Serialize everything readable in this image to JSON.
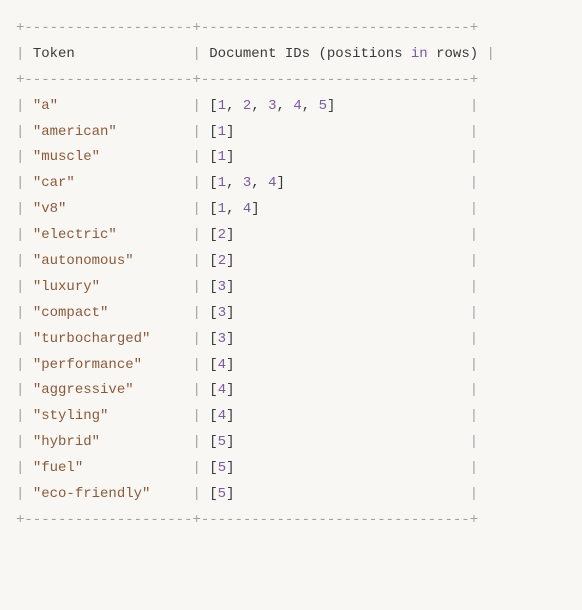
{
  "header": {
    "col1": "Token",
    "col2_before": "Document IDs (positions ",
    "col2_keyword": "in",
    "col2_after": " rows)"
  },
  "rows": [
    {
      "token": "\"a\"",
      "ids": [
        1,
        2,
        3,
        4,
        5
      ]
    },
    {
      "token": "\"american\"",
      "ids": [
        1
      ]
    },
    {
      "token": "\"muscle\"",
      "ids": [
        1
      ]
    },
    {
      "token": "\"car\"",
      "ids": [
        1,
        3,
        4
      ]
    },
    {
      "token": "\"v8\"",
      "ids": [
        1,
        4
      ]
    },
    {
      "token": "\"electric\"",
      "ids": [
        2
      ]
    },
    {
      "token": "\"autonomous\"",
      "ids": [
        2
      ]
    },
    {
      "token": "\"luxury\"",
      "ids": [
        3
      ]
    },
    {
      "token": "\"compact\"",
      "ids": [
        3
      ]
    },
    {
      "token": "\"turbocharged\"",
      "ids": [
        3
      ]
    },
    {
      "token": "\"performance\"",
      "ids": [
        4
      ]
    },
    {
      "token": "\"aggressive\"",
      "ids": [
        4
      ]
    },
    {
      "token": "\"styling\"",
      "ids": [
        4
      ]
    },
    {
      "token": "\"hybrid\"",
      "ids": [
        5
      ]
    },
    {
      "token": "\"fuel\"",
      "ids": [
        5
      ]
    },
    {
      "token": "\"eco-friendly\"",
      "ids": [
        5
      ]
    }
  ],
  "widths": {
    "col1": 18,
    "col2": 30
  }
}
